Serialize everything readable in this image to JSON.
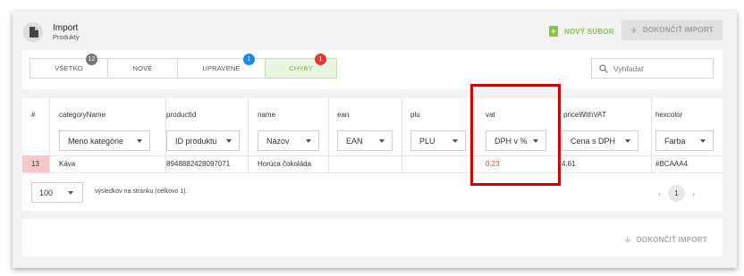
{
  "header": {
    "title": "Import",
    "subtitle": "Produkty",
    "new_file_label": "NOVÝ SÚBOR",
    "finish_label": "DOKONČIŤ IMPORT"
  },
  "tabs": [
    {
      "label": "VŠETKO",
      "badge": "12",
      "badge_color": "#757575",
      "active": false
    },
    {
      "label": "NOVÉ",
      "badge": null,
      "active": false
    },
    {
      "label": "UPRAVENÉ",
      "badge": "1",
      "badge_color": "#1e88e5",
      "active": false
    },
    {
      "label": "CHYBY",
      "badge": "1",
      "badge_color": "#e53935",
      "active": true
    }
  ],
  "search": {
    "placeholder": "Vyhľadať"
  },
  "table": {
    "row_header": "#",
    "columns": [
      {
        "name": "categoryName",
        "mapping": "Meno kategórie"
      },
      {
        "name": "productId",
        "mapping": "ID produktu"
      },
      {
        "name": "name",
        "mapping": "Názov"
      },
      {
        "name": "ean",
        "mapping": "EAN"
      },
      {
        "name": "plu",
        "mapping": "PLU"
      },
      {
        "name": "vat",
        "mapping": "DPH v %"
      },
      {
        "name": "priceWithVAT",
        "mapping": "Cena s DPH"
      },
      {
        "name": "hexcolor",
        "mapping": "Farba"
      }
    ],
    "rows": [
      {
        "num": "13",
        "cells": [
          "Káva",
          "8948882428097071",
          "Horúca čokoláda",
          "",
          "",
          "0.23",
          "4.61",
          "#BCAAA4"
        ]
      }
    ],
    "error_color": "#e53935",
    "error_row_color": "#f8c8c8"
  },
  "pagination": {
    "per_page": "100",
    "summary": "výsledkov na stránku (celkovo 1).",
    "prev": "‹",
    "current_page": "1",
    "next": "›"
  },
  "footer": {
    "finish_label": "DOKONČIŤ IMPORT"
  },
  "colors": {
    "accent_green": "#8bc34a",
    "highlight_red": "#d40000"
  }
}
